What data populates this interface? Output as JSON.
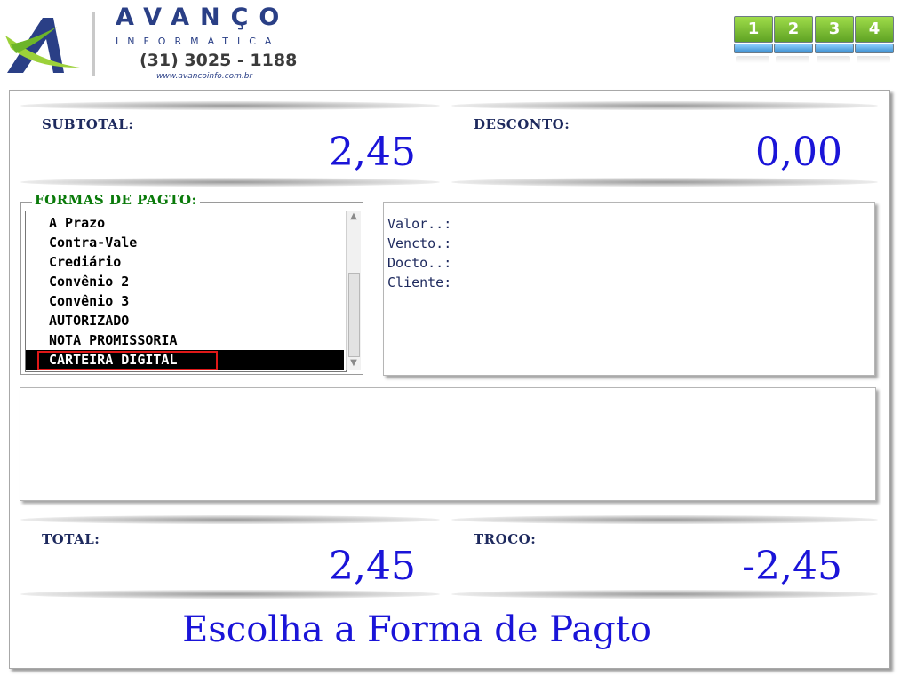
{
  "header": {
    "brand_name": "AVANÇO",
    "brand_subtitle": "INFORMÁTICA",
    "phone": "(31) 3025 - 1188",
    "website": "www.avancoinfo.com.br",
    "steps": [
      "1",
      "2",
      "3",
      "4"
    ]
  },
  "summary": {
    "subtotal_label": "SUBTOTAL:",
    "subtotal_value": "2,45",
    "discount_label": "DESCONTO:",
    "discount_value": "0,00",
    "total_label": "TOTAL:",
    "total_value": "2,45",
    "change_label": "TROCO:",
    "change_value": "-2,45"
  },
  "payment_methods": {
    "legend": "FORMAS DE PAGTO:",
    "items": [
      "A Prazo",
      "Contra-Vale",
      "Crediário",
      "Convênio 2",
      "Convênio 3",
      "AUTORIZADO",
      "NOTA PROMISSORIA",
      "CARTEIRA DIGITAL"
    ],
    "selected_index": 7
  },
  "details": {
    "lines": [
      "Valor..:",
      "Vencto.:",
      "Docto..:",
      "Cliente:"
    ]
  },
  "status_message": "Escolha a Forma de Pagto",
  "colors": {
    "value_blue": "#1a14d8",
    "label_navy": "#1e2a5e",
    "legend_green": "#0a7a0a",
    "highlight_red": "#e01818",
    "step_green": "#6fb22c",
    "brand_blue": "#2a3f86"
  }
}
